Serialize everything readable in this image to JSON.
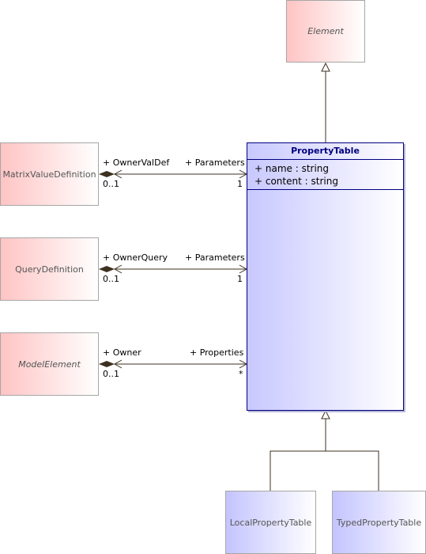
{
  "classes": {
    "element": {
      "name": "Element",
      "abstract": true
    },
    "property_table": {
      "name": "PropertyTable",
      "attributes": [
        "+ name : string",
        "+ content : string"
      ]
    },
    "matrix_value_definition": {
      "name": "MatrixValueDefinition",
      "abstract": false
    },
    "query_definition": {
      "name": "QueryDefinition",
      "abstract": false
    },
    "model_element": {
      "name": "ModelElement",
      "abstract": true
    },
    "local_property_table": {
      "name": "LocalPropertyTable",
      "abstract": false
    },
    "typed_property_table": {
      "name": "TypedPropertyTable",
      "abstract": false
    }
  },
  "associations": [
    {
      "source": "MatrixValueDefinition",
      "source_role": "+ OwnerValDef",
      "source_mult": "0..1",
      "target": "PropertyTable",
      "target_role": "+ Parameters",
      "target_mult": "1",
      "kind": "composition"
    },
    {
      "source": "QueryDefinition",
      "source_role": "+ OwnerQuery",
      "source_mult": "0..1",
      "target": "PropertyTable",
      "target_role": "+ Parameters",
      "target_mult": "1",
      "kind": "composition"
    },
    {
      "source": "ModelElement",
      "source_role": "+ Owner",
      "source_mult": "0..1",
      "target": "PropertyTable",
      "target_role": "+ Properties",
      "target_mult": "*",
      "kind": "composition"
    }
  ],
  "generalizations": [
    {
      "child": "PropertyTable",
      "parent": "Element"
    },
    {
      "child": "LocalPropertyTable",
      "parent": "PropertyTable"
    },
    {
      "child": "TypedPropertyTable",
      "parent": "PropertyTable"
    }
  ],
  "colors": {
    "line": "#3c3020",
    "property_table_border": "#000080",
    "related_gradient_start": "#ffc4c4",
    "subclass_gradient_start": "#c4c4ff"
  }
}
